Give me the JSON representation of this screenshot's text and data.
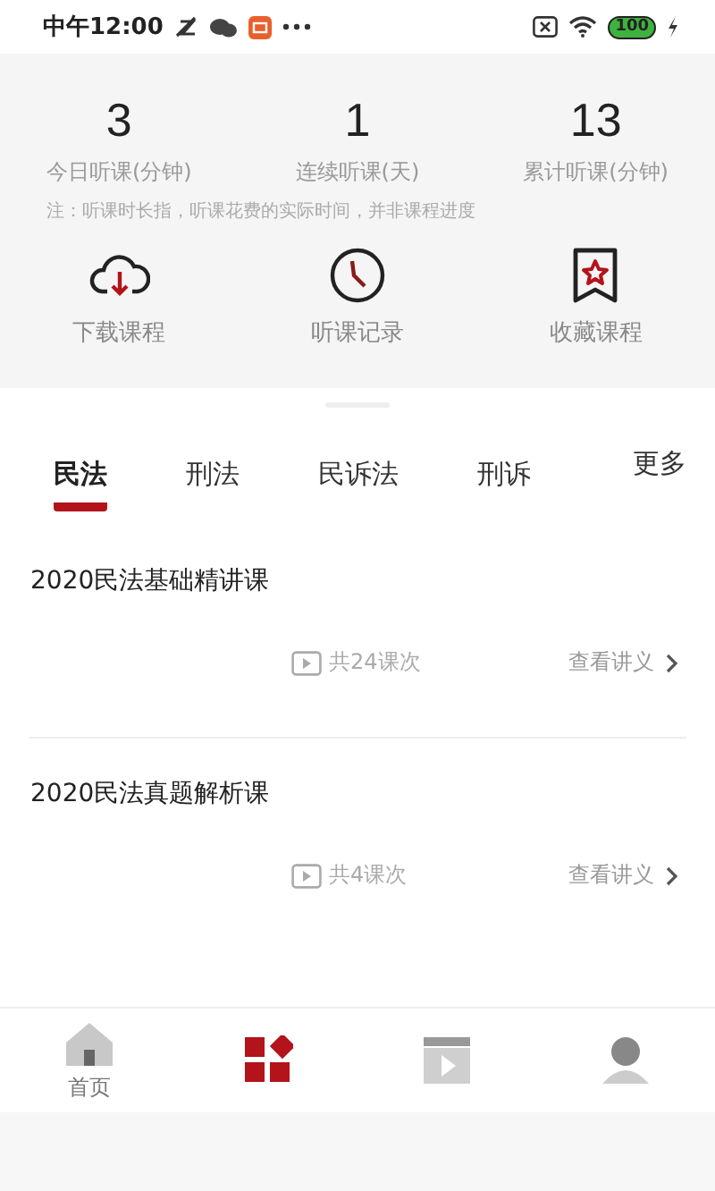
{
  "status_bar": {
    "time": "中午12:00",
    "battery": "100"
  },
  "stats": [
    {
      "value": "3",
      "label": "今日听课(分钟)"
    },
    {
      "value": "1",
      "label": "连续听课(天)"
    },
    {
      "value": "13",
      "label": "累计听课(分钟)"
    }
  ],
  "note": "注：听课时长指，听课花费的实际时间，并非课程进度",
  "shortcuts": [
    {
      "kind": "download",
      "label": "下载课程"
    },
    {
      "kind": "history",
      "label": "听课记录"
    },
    {
      "kind": "favorite",
      "label": "收藏课程"
    }
  ],
  "tabs": [
    {
      "label": "民法",
      "selected": true
    },
    {
      "label": "刑法",
      "selected": false
    },
    {
      "label": "民诉法",
      "selected": false
    },
    {
      "label": "刑诉",
      "selected": false
    }
  ],
  "more": "更多",
  "courses": [
    {
      "title": "2020民法基础精讲课",
      "count": "共24课次",
      "action": "查看讲义"
    },
    {
      "title": "2020民法真题解析课",
      "count": "共4课次",
      "action": "查看讲义"
    }
  ],
  "nav": [
    {
      "kind": "home",
      "label": "首页",
      "selected": false
    },
    {
      "kind": "courses",
      "selected": true
    },
    {
      "kind": "video",
      "selected": false
    },
    {
      "kind": "profile",
      "selected": false
    }
  ]
}
